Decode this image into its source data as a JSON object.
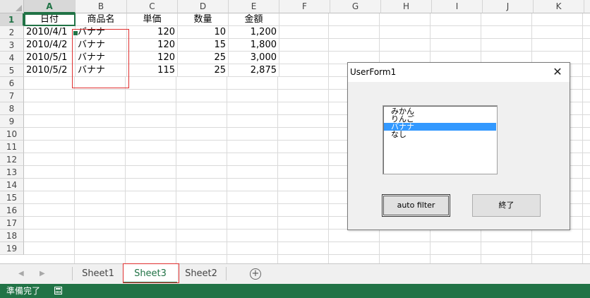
{
  "columns": [
    "A",
    "B",
    "C",
    "D",
    "E",
    "F",
    "G",
    "H",
    "I",
    "J",
    "K"
  ],
  "rows": [
    "1",
    "2",
    "3",
    "4",
    "5",
    "6",
    "7",
    "8",
    "9",
    "10",
    "11",
    "12",
    "13",
    "14",
    "15",
    "16",
    "17",
    "18",
    "19"
  ],
  "cells": {
    "headers": [
      "日付",
      "商品名",
      "単価",
      "数量",
      "金額"
    ],
    "data": [
      [
        "2010/4/1",
        "バナナ",
        "120",
        "10",
        "1,200"
      ],
      [
        "2010/4/2",
        "バナナ",
        "120",
        "15",
        "1,800"
      ],
      [
        "2010/5/1",
        "バナナ",
        "120",
        "25",
        "3,000"
      ],
      [
        "2010/5/2",
        "バナナ",
        "115",
        "25",
        "2,875"
      ]
    ]
  },
  "tabs": [
    "Sheet1",
    "Sheet3",
    "Sheet2"
  ],
  "active_tab": "Sheet3",
  "status": {
    "text": "準備完了"
  },
  "userform": {
    "title": "UserForm1",
    "close_glyph": "✕",
    "list_items": [
      "みかん",
      "りんご",
      "バナナ",
      "なし"
    ],
    "selected_item": "バナナ",
    "auto_filter_label": "auto  filter",
    "exit_label": "終了"
  },
  "nav": {
    "prev": "◀",
    "next": "▶",
    "add": "+"
  },
  "colors": {
    "excel_green": "#217346",
    "highlight": "#3399ff",
    "annotation_red": "#e03030"
  }
}
